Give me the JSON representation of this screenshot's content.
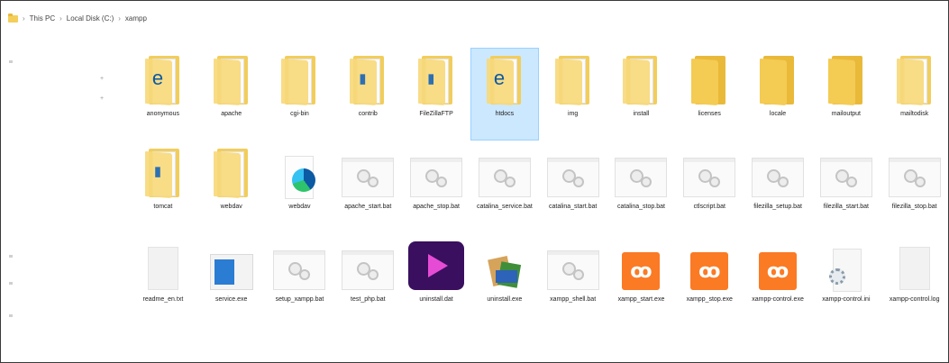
{
  "breadcrumb": {
    "items": [
      "This PC",
      "Local Disk (C:)",
      "xampp"
    ]
  },
  "files": [
    {
      "label": "anonymous",
      "icon": "folder-edge-icon",
      "kind": "edge-folder"
    },
    {
      "label": "apache",
      "icon": "folder-icon",
      "kind": "folder"
    },
    {
      "label": "cgi-bin",
      "icon": "folder-icon",
      "kind": "folder"
    },
    {
      "label": "contrib",
      "icon": "folder-icon",
      "kind": "folder-doc"
    },
    {
      "label": "FileZillaFTP",
      "icon": "folder-icon",
      "kind": "folder-doc"
    },
    {
      "label": "htdocs",
      "icon": "folder-edge-icon",
      "kind": "edge-folder",
      "selected": true
    },
    {
      "label": "img",
      "icon": "folder-icon",
      "kind": "folder"
    },
    {
      "label": "install",
      "icon": "folder-icon",
      "kind": "folder"
    },
    {
      "label": "licenses",
      "icon": "folder-icon",
      "kind": "folder-closed"
    },
    {
      "label": "locale",
      "icon": "folder-icon",
      "kind": "folder-closed"
    },
    {
      "label": "mailoutput",
      "icon": "folder-icon",
      "kind": "folder-closed"
    },
    {
      "label": "mailtodisk",
      "icon": "folder-icon",
      "kind": "folder"
    },
    {
      "label": "tomcat",
      "icon": "folder-icon",
      "kind": "folder-doc"
    },
    {
      "label": "webdav",
      "icon": "folder-icon",
      "kind": "folder"
    },
    {
      "label": "webdav",
      "icon": "edge-file-icon",
      "kind": "edge-file"
    },
    {
      "label": "apache_start.bat",
      "icon": "batch-file-icon",
      "kind": "gear"
    },
    {
      "label": "apache_stop.bat",
      "icon": "batch-file-icon",
      "kind": "gear"
    },
    {
      "label": "catalina_service.bat",
      "icon": "batch-file-icon",
      "kind": "gear"
    },
    {
      "label": "catalina_start.bat",
      "icon": "batch-file-icon",
      "kind": "gear"
    },
    {
      "label": "catalina_stop.bat",
      "icon": "batch-file-icon",
      "kind": "gear"
    },
    {
      "label": "ctlscript.bat",
      "icon": "batch-file-icon",
      "kind": "gear"
    },
    {
      "label": "filezilla_setup.bat",
      "icon": "batch-file-icon",
      "kind": "gear"
    },
    {
      "label": "filezilla_start.bat",
      "icon": "batch-file-icon",
      "kind": "gear"
    },
    {
      "label": "filezilla_stop.bat",
      "icon": "batch-file-icon",
      "kind": "gear"
    },
    {
      "label": "readme_en.txt",
      "icon": "text-file-icon",
      "kind": "blank"
    },
    {
      "label": "service.exe",
      "icon": "exe-file-icon",
      "kind": "exe"
    },
    {
      "label": "setup_xampp.bat",
      "icon": "batch-file-icon",
      "kind": "gear"
    },
    {
      "label": "test_php.bat",
      "icon": "batch-file-icon",
      "kind": "gear"
    },
    {
      "label": "uninstall.dat",
      "icon": "wondershare-icon",
      "kind": "wondershare"
    },
    {
      "label": "uninstall.exe",
      "icon": "winrar-icon",
      "kind": "winrar"
    },
    {
      "label": "xampp_shell.bat",
      "icon": "batch-file-icon",
      "kind": "gear"
    },
    {
      "label": "xampp_start.exe",
      "icon": "xampp-icon",
      "kind": "xampp"
    },
    {
      "label": "xampp_stop.exe",
      "icon": "xampp-icon",
      "kind": "xampp"
    },
    {
      "label": "xampp-control.exe",
      "icon": "xampp-icon",
      "kind": "xampp"
    },
    {
      "label": "xampp-control.ini",
      "icon": "config-file-icon",
      "kind": "cfg"
    },
    {
      "label": "xampp-control.log",
      "icon": "text-file-icon",
      "kind": "blank"
    }
  ]
}
